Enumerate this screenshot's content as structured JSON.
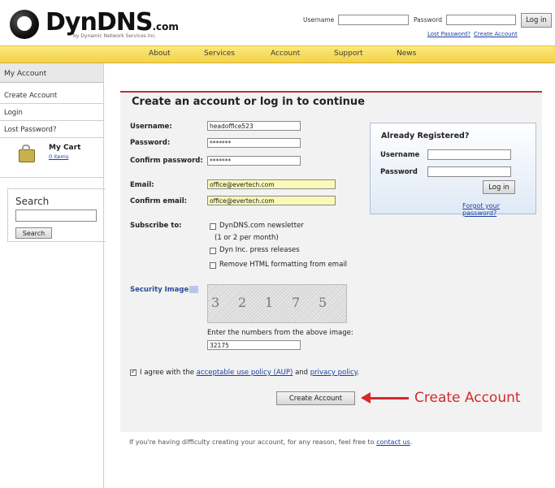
{
  "header": {
    "logo_text": "DynDNS",
    "logo_com": ".com",
    "logo_sub": "by Dynamic Network Services Inc.",
    "username_label": "Username",
    "password_label": "Password",
    "login_button": "Log in",
    "lost_password_link": "Lost Password?",
    "create_account_link": "Create Account"
  },
  "nav": [
    "About",
    "Services",
    "Account",
    "Support",
    "News"
  ],
  "sidebar": {
    "title": "My Account",
    "items": [
      "Create Account",
      "Login",
      "Lost Password?"
    ],
    "cart_title": "My Cart",
    "cart_items": "0 items",
    "search_title": "Search",
    "search_button": "Search"
  },
  "main": {
    "title": "Create an account or log in to continue",
    "username_label": "Username:",
    "username_value": "headoffice523",
    "password_label": "Password:",
    "password_value": "*******",
    "confirm_password_label": "Confirm password:",
    "confirm_password_value": "*******",
    "email_label": "Email:",
    "email_value": "office@evertech.com",
    "confirm_email_label": "Confirm email:",
    "confirm_email_value": "office@evertech.com",
    "subscribe_label": "Subscribe to:",
    "subscribe_options": [
      "DynDNS.com newsletter",
      "(1 or 2 per month)",
      "Dyn Inc. press releases",
      "Remove HTML formatting from email"
    ],
    "security_image_label": "Security Image:",
    "captcha_digits": [
      "3",
      "2",
      "1",
      "7",
      "5"
    ],
    "captcha_instruction": "Enter the numbers from the above image:",
    "captcha_value": "32175",
    "agree_prefix": "I agree with the",
    "agree_aup": "acceptable use policy (AUP)",
    "agree_and": "and",
    "agree_privacy": "privacy policy",
    "agree_suffix": ".",
    "create_button": "Create Account",
    "annotation": "Create Account",
    "footer_text": "If you're having difficulty creating your account, for any reason, feel free to",
    "footer_link": "contact us",
    "footer_suffix": "."
  },
  "registered": {
    "title": "Already Registered?",
    "username_label": "Username",
    "password_label": "Password",
    "login_button": "Log in",
    "forgot_link": "Forgot your password?"
  },
  "colors": {
    "nav_yellow": "#f2d24a",
    "accent_red": "#b8343a",
    "annotation_red": "#d82828",
    "link_blue": "#1a3fa3"
  }
}
